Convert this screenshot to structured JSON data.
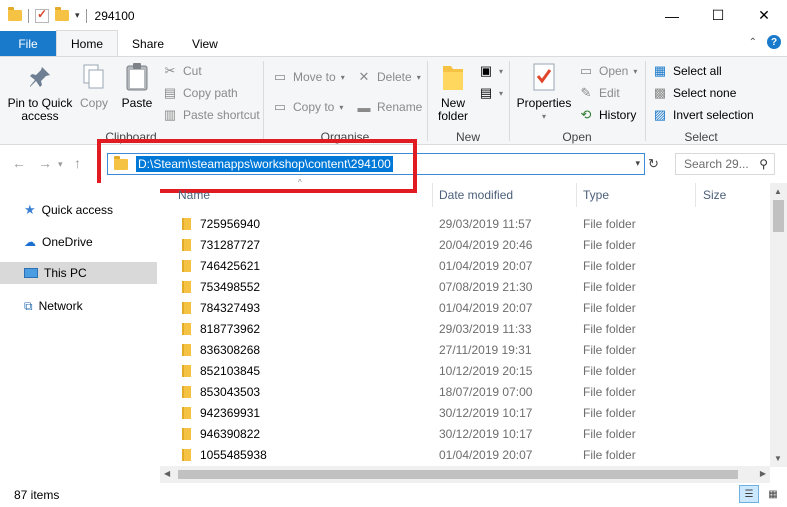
{
  "titlebar": {
    "title": "294100",
    "minimize": "—",
    "maximize": "☐",
    "close": "✕"
  },
  "tabs": {
    "file": "File",
    "home": "Home",
    "share": "Share",
    "view": "View"
  },
  "ribbon": {
    "clipboard": {
      "label": "Clipboard",
      "pin_line1": "Pin to Quick",
      "pin_line2": "access",
      "copy": "Copy",
      "paste": "Paste",
      "cut": "Cut",
      "copy_path": "Copy path",
      "paste_shortcut": "Paste shortcut"
    },
    "organise": {
      "label": "Organise",
      "move_to": "Move to",
      "copy_to": "Copy to",
      "delete": "Delete",
      "rename": "Rename"
    },
    "new": {
      "label": "New",
      "new_folder_line1": "New",
      "new_folder_line2": "folder"
    },
    "open": {
      "label": "Open",
      "properties": "Properties",
      "open": "Open",
      "edit": "Edit",
      "history": "History"
    },
    "select": {
      "label": "Select",
      "select_all": "Select all",
      "select_none": "Select none",
      "invert_selection": "Invert selection"
    }
  },
  "address": {
    "path": "D:\\Steam\\steamapps\\workshop\\content\\294100",
    "search_placeholder": "Search 29..."
  },
  "nav": {
    "quick_access": "Quick access",
    "onedrive": "OneDrive",
    "this_pc": "This PC",
    "network": "Network"
  },
  "columns": {
    "name": "Name",
    "date_modified": "Date modified",
    "type": "Type",
    "size": "Size"
  },
  "files": [
    {
      "name": "725956940",
      "date": "29/03/2019 11:57",
      "type": "File folder"
    },
    {
      "name": "731287727",
      "date": "20/04/2019 20:46",
      "type": "File folder"
    },
    {
      "name": "746425621",
      "date": "01/04/2019 20:07",
      "type": "File folder"
    },
    {
      "name": "753498552",
      "date": "07/08/2019 21:30",
      "type": "File folder"
    },
    {
      "name": "784327493",
      "date": "01/04/2019 20:07",
      "type": "File folder"
    },
    {
      "name": "818773962",
      "date": "29/03/2019 11:33",
      "type": "File folder"
    },
    {
      "name": "836308268",
      "date": "27/11/2019 19:31",
      "type": "File folder"
    },
    {
      "name": "852103845",
      "date": "10/12/2019 20:15",
      "type": "File folder"
    },
    {
      "name": "853043503",
      "date": "18/07/2019 07:00",
      "type": "File folder"
    },
    {
      "name": "942369931",
      "date": "30/12/2019 10:17",
      "type": "File folder"
    },
    {
      "name": "946390822",
      "date": "30/12/2019 10:17",
      "type": "File folder"
    },
    {
      "name": "1055485938",
      "date": "01/04/2019 20:07",
      "type": "File folder"
    }
  ],
  "status": {
    "item_count": "87 items"
  }
}
